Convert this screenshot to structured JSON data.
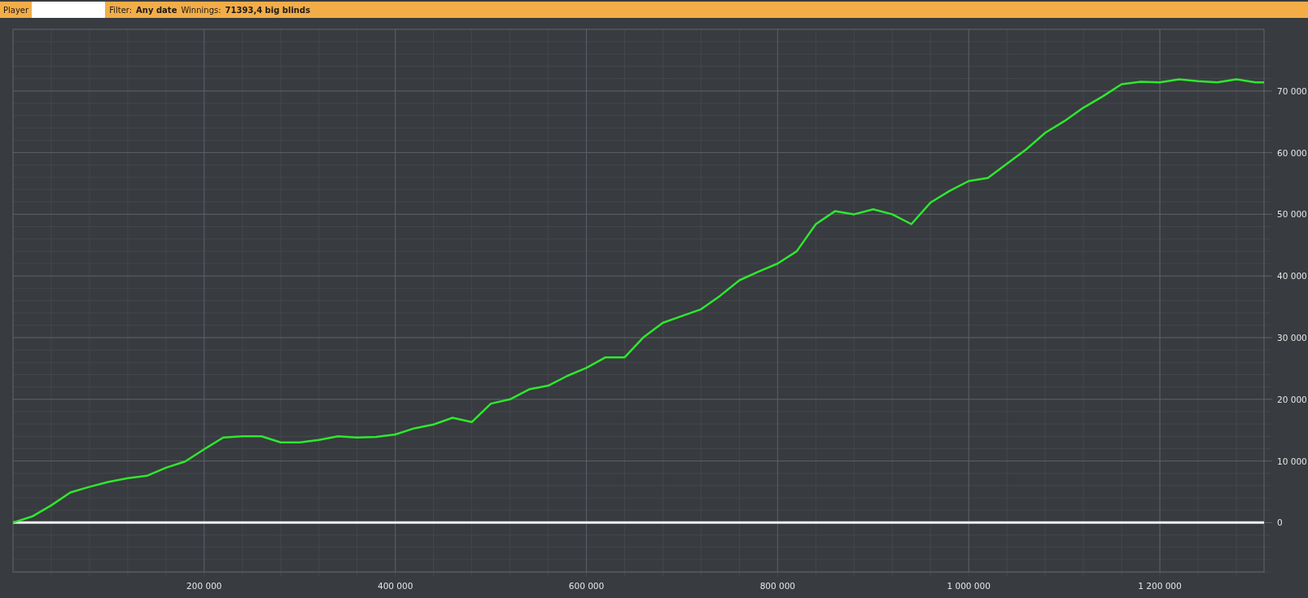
{
  "toolbar": {
    "player_label": "Player",
    "filter_label": "Filter:",
    "filter_value": "Any date",
    "winnings_label": "Winnings:",
    "winnings_value": "71393,4 big blinds"
  },
  "graph": {
    "chart_data": {
      "type": "line",
      "grid": true,
      "x": [
        0,
        20000,
        40000,
        60000,
        80000,
        100000,
        120000,
        140000,
        160000,
        180000,
        200000,
        220000,
        240000,
        260000,
        280000,
        300000,
        320000,
        340000,
        360000,
        380000,
        400000,
        420000,
        440000,
        460000,
        480000,
        500000,
        520000,
        540000,
        560000,
        580000,
        600000,
        620000,
        640000,
        660000,
        680000,
        700000,
        720000,
        740000,
        760000,
        780000,
        800000,
        820000,
        840000,
        860000,
        880000,
        900000,
        920000,
        940000,
        960000,
        980000,
        1000000,
        1020000,
        1040000,
        1060000,
        1080000,
        1100000,
        1120000,
        1140000,
        1160000,
        1180000,
        1200000,
        1220000,
        1240000,
        1260000,
        1280000,
        1300000,
        1309000
      ],
      "series": [
        {
          "color": "#2ee82e",
          "values": [
            0,
            1000,
            2800,
            4900,
            5800,
            6600,
            7200,
            7600,
            8900,
            9900,
            11900,
            13800,
            14000,
            14000,
            13000,
            13000,
            13400,
            14000,
            13800,
            13900,
            14300,
            15300,
            15900,
            17000,
            16300,
            19300,
            20000,
            21600,
            22200,
            23800,
            25100,
            26800,
            26800,
            30100,
            32400,
            33500,
            34600,
            36800,
            39300,
            40700,
            42000,
            44000,
            48400,
            50500,
            50000,
            50800,
            50000,
            48400,
            51900,
            53800,
            55400,
            55900,
            58200,
            60500,
            63200,
            65100,
            67300,
            69100,
            71100,
            71500,
            71400,
            71900,
            71600,
            71400,
            71900,
            71400,
            71400
          ]
        }
      ],
      "xlim": [
        0,
        1309000
      ],
      "ylim": [
        -8000,
        80000
      ],
      "xticks": [
        {
          "value": 200000,
          "label": "200 000"
        },
        {
          "value": 400000,
          "label": "400 000"
        },
        {
          "value": 600000,
          "label": "600 000"
        },
        {
          "value": 800000,
          "label": "800 000"
        },
        {
          "value": 1000000,
          "label": "1 000 000"
        },
        {
          "value": 1200000,
          "label": "1 200 000"
        }
      ],
      "yticks": [
        {
          "value": 0,
          "label": "0"
        },
        {
          "value": 10000,
          "label": "10 000"
        },
        {
          "value": 20000,
          "label": "20 000"
        },
        {
          "value": 30000,
          "label": "30 000"
        },
        {
          "value": 40000,
          "label": "40 000"
        },
        {
          "value": 50000,
          "label": "50 000"
        },
        {
          "value": 60000,
          "label": "60 000"
        },
        {
          "value": 70000,
          "label": "70 000"
        }
      ]
    }
  }
}
